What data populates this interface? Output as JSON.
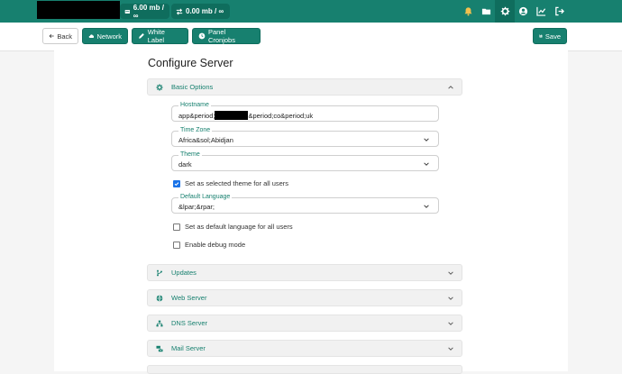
{
  "topbar": {
    "storage": "6.00 mb / ∞",
    "transfer": "0.00 mb / ∞",
    "icons": [
      "bell-icon",
      "folder-icon",
      "gear-icon",
      "user-circle-icon",
      "chart-line-icon",
      "logout-icon"
    ]
  },
  "toolbar": {
    "back_label": "Back",
    "network_label": "Network",
    "white_label_label": "White Label",
    "cronjobs_label": "Panel Cronjobs",
    "save_label": "Save"
  },
  "page": {
    "title": "Configure Server"
  },
  "basic": {
    "header": "Basic Options",
    "hostname_label": "Hostname",
    "hostname_prefix": "app&period;",
    "hostname_suffix": "&period;co&period;uk",
    "timezone_label": "Time Zone",
    "timezone_value": "Africa&sol;Abidjan",
    "theme_label": "Theme",
    "theme_value": "dark",
    "theme_all_users": "Set as selected theme for all users",
    "language_label": "Default Language",
    "language_value": "&lpar;&rpar;",
    "language_all_users": "Set as default language for all users",
    "debug_mode": "Enable debug mode"
  },
  "sections": {
    "updates": "Updates",
    "web_server": "Web Server",
    "dns_server": "DNS Server",
    "mail_server": "Mail Server"
  },
  "colors": {
    "brand": "#17806f",
    "brand_dark": "#0f6d5d",
    "checkbox": "#1a73e8"
  }
}
